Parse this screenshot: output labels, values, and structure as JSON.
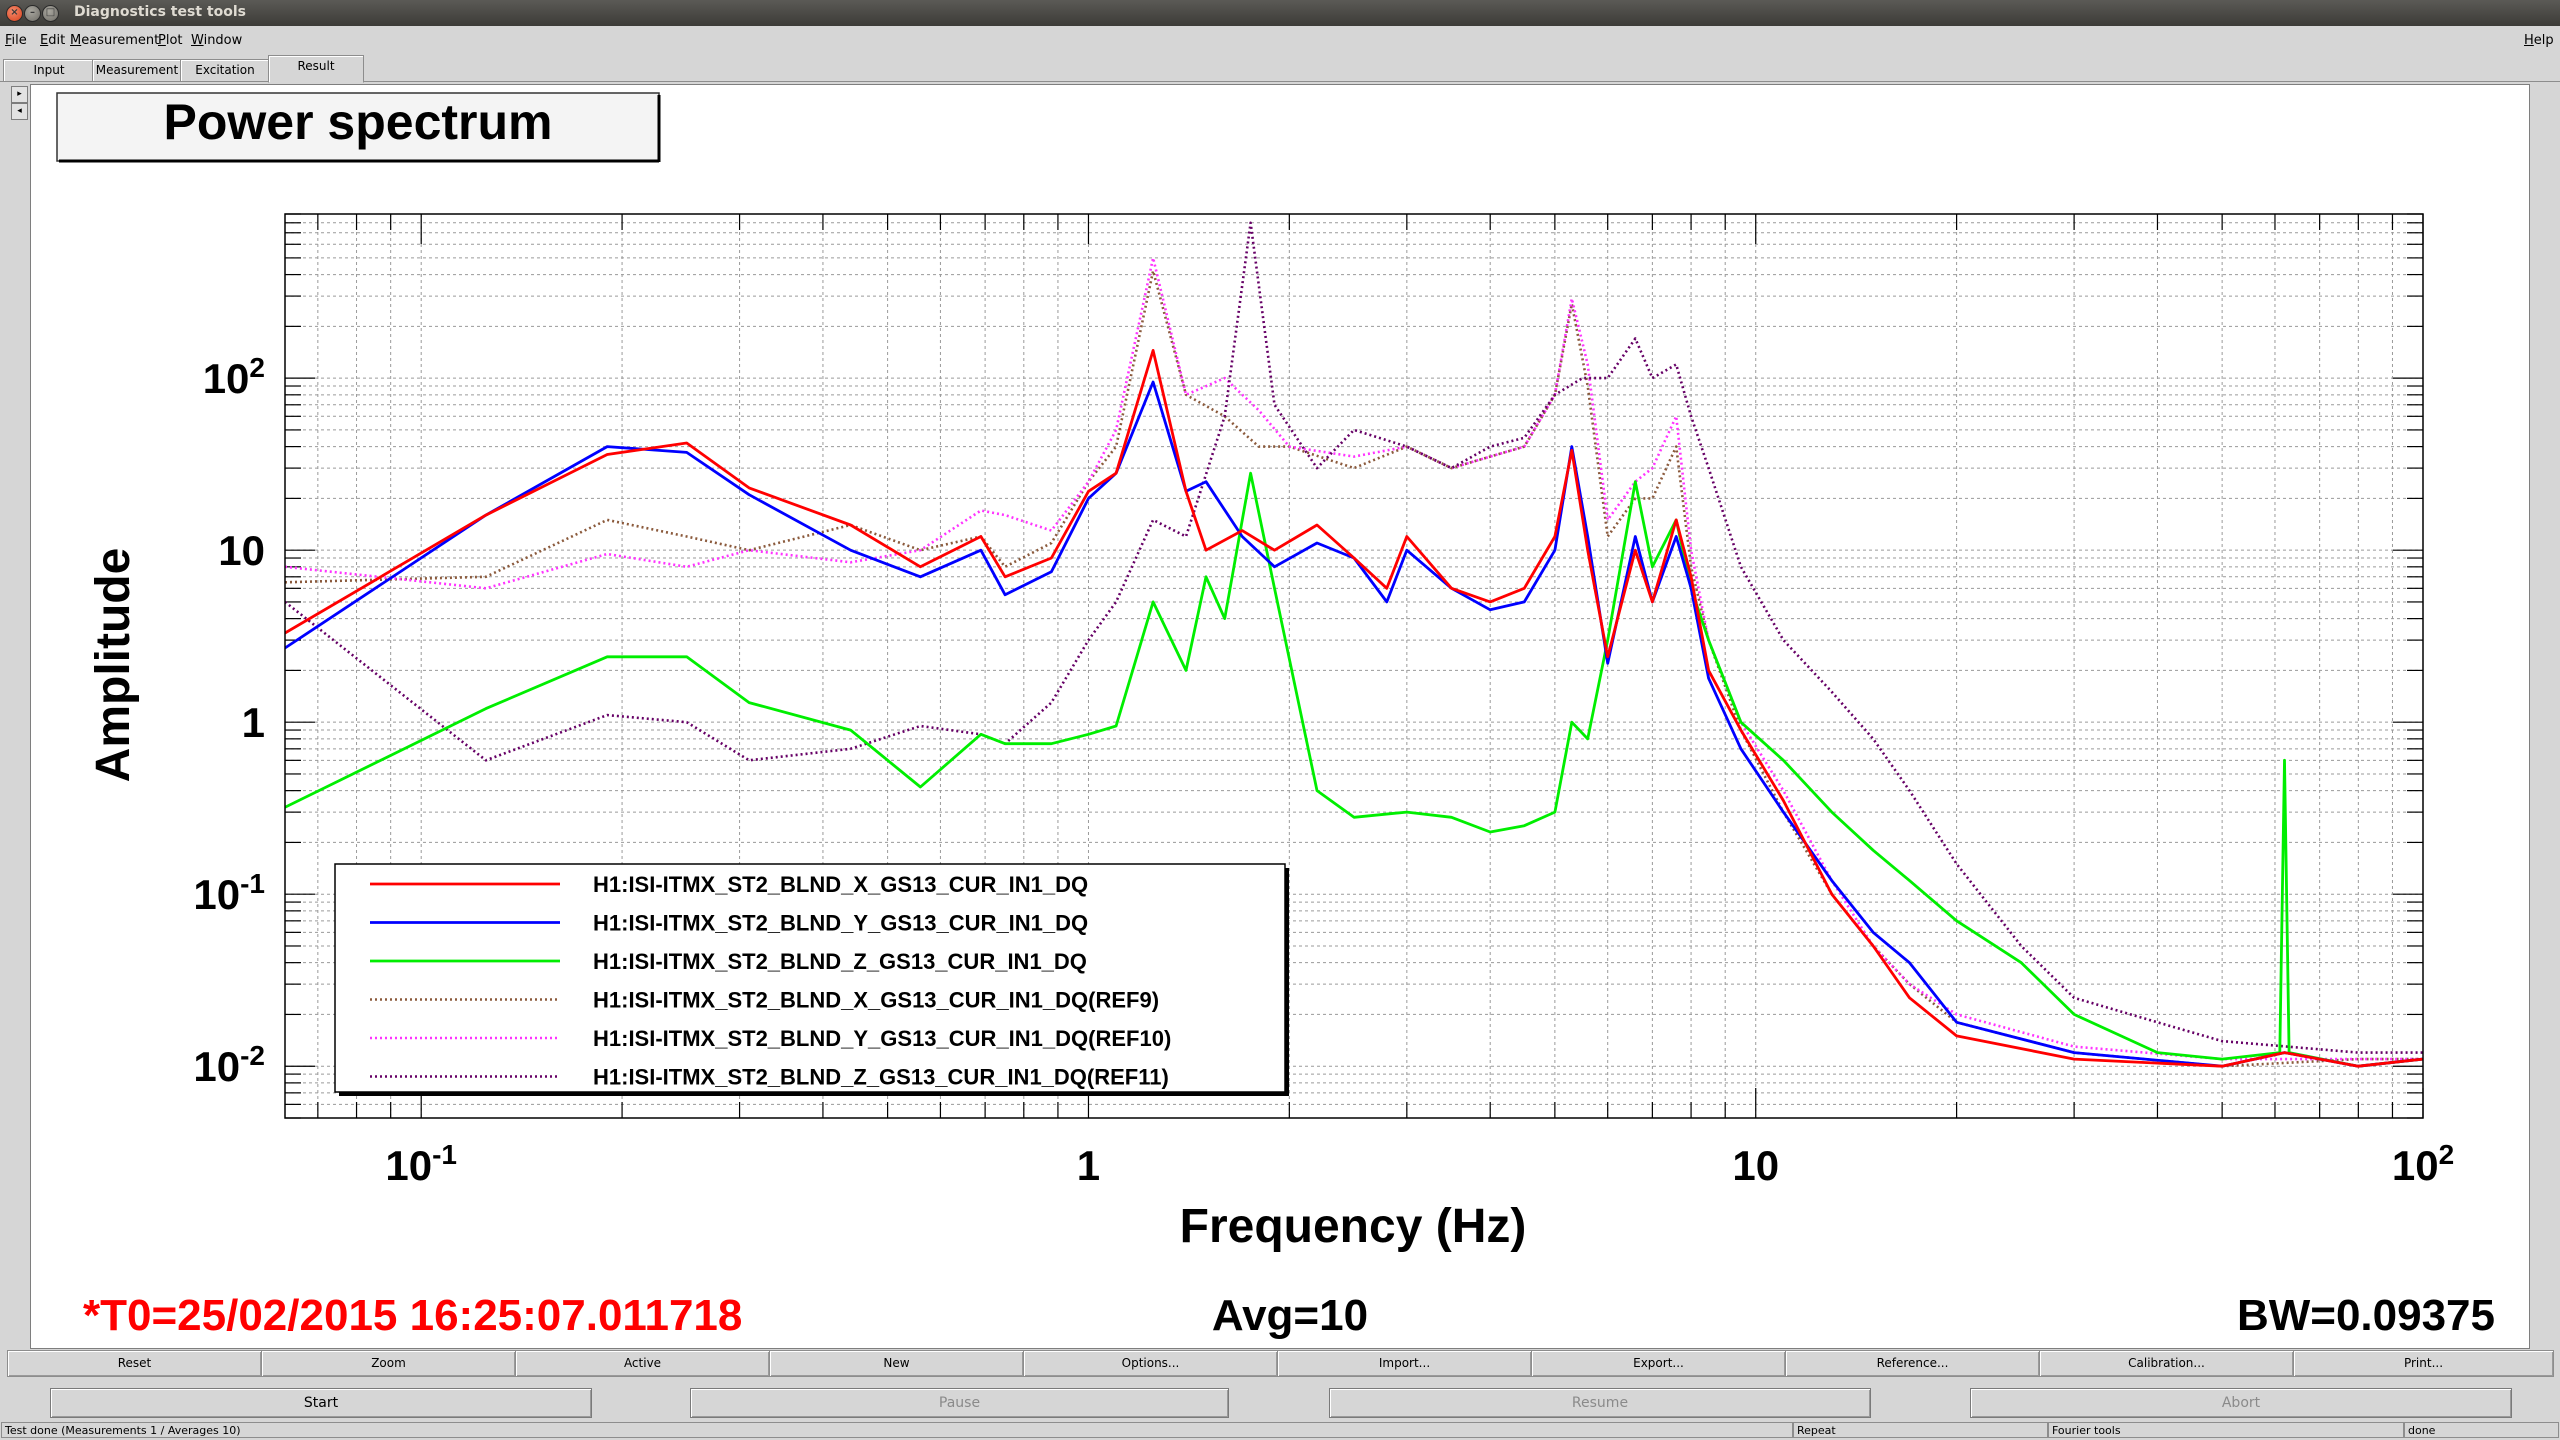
{
  "window": {
    "title": "Diagnostics test tools",
    "close_glyph": "×",
    "min_glyph": "–",
    "max_glyph": "□"
  },
  "menu": {
    "items": [
      "File",
      "Edit",
      "Measurement",
      "Plot",
      "Window"
    ],
    "help": "Help"
  },
  "tabs": [
    "Input",
    "Measurement",
    "Excitation",
    "Result"
  ],
  "active_tab": "Result",
  "scroll": {
    "right": "▸",
    "left": "◂"
  },
  "plot": {
    "title": "Power spectrum",
    "t0": "*T0=25/02/2015 16:25:07.011718",
    "avg": "Avg=10",
    "bw": "BW=0.09375",
    "colors": {
      "X": "#ff0000",
      "Y": "#0000ff",
      "Z": "#00ee00",
      "REF9": "#8b5a3c",
      "REF10": "#ff33ff",
      "REF11": "#660066",
      "t0": "#ff0000"
    }
  },
  "chart_data": {
    "type": "line",
    "title": "Power spectrum",
    "xlabel": "Frequency (Hz)",
    "ylabel": "Amplitude",
    "xscale": "log",
    "yscale": "log",
    "xlim": [
      0.0625,
      100
    ],
    "ylim": [
      0.005,
      900
    ],
    "grid": true,
    "legend_position": "bottom-left",
    "x_ticks": [
      {
        "value": 0.1,
        "base": "10",
        "exp": "-1"
      },
      {
        "value": 1,
        "base": "1",
        "exp": ""
      },
      {
        "value": 10,
        "base": "10",
        "exp": ""
      },
      {
        "value": 100,
        "base": "10",
        "exp": "2"
      }
    ],
    "y_ticks": [
      {
        "value": 100,
        "base": "10",
        "exp": "2"
      },
      {
        "value": 10,
        "base": "10",
        "exp": ""
      },
      {
        "value": 1,
        "base": "1",
        "exp": ""
      },
      {
        "value": 0.1,
        "base": "10",
        "exp": "-1"
      },
      {
        "value": 0.01,
        "base": "10",
        "exp": "-2"
      }
    ],
    "series": [
      {
        "name": "H1:ISI-ITMX_ST2_BLND_X_GS13_CUR_IN1_DQ",
        "key": "X",
        "dash": "solid",
        "points": [
          [
            0.0625,
            3.3
          ],
          [
            0.125,
            16
          ],
          [
            0.19,
            36
          ],
          [
            0.25,
            42
          ],
          [
            0.31,
            23
          ],
          [
            0.44,
            14
          ],
          [
            0.56,
            8
          ],
          [
            0.69,
            12
          ],
          [
            0.75,
            7
          ],
          [
            0.88,
            9
          ],
          [
            1.0,
            22
          ],
          [
            1.1,
            28
          ],
          [
            1.25,
            145
          ],
          [
            1.4,
            22
          ],
          [
            1.5,
            10
          ],
          [
            1.7,
            13
          ],
          [
            1.9,
            10
          ],
          [
            2.2,
            14
          ],
          [
            2.5,
            9
          ],
          [
            2.8,
            6
          ],
          [
            3.0,
            12
          ],
          [
            3.5,
            6
          ],
          [
            4.0,
            5
          ],
          [
            4.5,
            6
          ],
          [
            5.0,
            12
          ],
          [
            5.3,
            38
          ],
          [
            5.6,
            10
          ],
          [
            6.0,
            2.4
          ],
          [
            6.6,
            10
          ],
          [
            7.0,
            5
          ],
          [
            7.6,
            15
          ],
          [
            8.0,
            7
          ],
          [
            8.5,
            2
          ],
          [
            9.5,
            0.9
          ],
          [
            11,
            0.35
          ],
          [
            13,
            0.1
          ],
          [
            15,
            0.05
          ],
          [
            17,
            0.025
          ],
          [
            20,
            0.015
          ],
          [
            30,
            0.011
          ],
          [
            50,
            0.01
          ],
          [
            62,
            0.012
          ],
          [
            80,
            0.01
          ],
          [
            100,
            0.011
          ]
        ]
      },
      {
        "name": "H1:ISI-ITMX_ST2_BLND_Y_GS13_CUR_IN1_DQ",
        "key": "Y",
        "dash": "solid",
        "points": [
          [
            0.0625,
            2.7
          ],
          [
            0.125,
            16
          ],
          [
            0.19,
            40
          ],
          [
            0.25,
            37
          ],
          [
            0.31,
            21
          ],
          [
            0.44,
            10
          ],
          [
            0.56,
            7
          ],
          [
            0.69,
            10
          ],
          [
            0.75,
            5.5
          ],
          [
            0.88,
            7.5
          ],
          [
            1.0,
            20
          ],
          [
            1.1,
            28
          ],
          [
            1.25,
            95
          ],
          [
            1.4,
            22
          ],
          [
            1.5,
            25
          ],
          [
            1.7,
            12
          ],
          [
            1.9,
            8
          ],
          [
            2.2,
            11
          ],
          [
            2.5,
            9
          ],
          [
            2.8,
            5
          ],
          [
            3.0,
            10
          ],
          [
            3.5,
            6
          ],
          [
            4.0,
            4.5
          ],
          [
            4.5,
            5
          ],
          [
            5.0,
            10
          ],
          [
            5.3,
            40
          ],
          [
            5.6,
            12
          ],
          [
            6.0,
            2.2
          ],
          [
            6.6,
            12
          ],
          [
            7.0,
            5
          ],
          [
            7.6,
            12
          ],
          [
            8.0,
            6
          ],
          [
            8.5,
            1.8
          ],
          [
            9.5,
            0.7
          ],
          [
            11,
            0.3
          ],
          [
            13,
            0.12
          ],
          [
            15,
            0.06
          ],
          [
            17,
            0.04
          ],
          [
            20,
            0.018
          ],
          [
            30,
            0.012
          ],
          [
            50,
            0.01
          ],
          [
            62,
            0.012
          ],
          [
            80,
            0.01
          ],
          [
            100,
            0.011
          ]
        ]
      },
      {
        "name": "H1:ISI-ITMX_ST2_BLND_Z_GS13_CUR_IN1_DQ",
        "key": "Z",
        "dash": "solid",
        "points": [
          [
            0.0625,
            0.32
          ],
          [
            0.125,
            1.2
          ],
          [
            0.19,
            2.4
          ],
          [
            0.25,
            2.4
          ],
          [
            0.31,
            1.3
          ],
          [
            0.44,
            0.9
          ],
          [
            0.56,
            0.42
          ],
          [
            0.69,
            0.85
          ],
          [
            0.75,
            0.75
          ],
          [
            0.88,
            0.75
          ],
          [
            1.0,
            0.85
          ],
          [
            1.1,
            0.95
          ],
          [
            1.25,
            5
          ],
          [
            1.4,
            2
          ],
          [
            1.5,
            7
          ],
          [
            1.6,
            4
          ],
          [
            1.75,
            28
          ],
          [
            1.9,
            6
          ],
          [
            2.2,
            0.4
          ],
          [
            2.5,
            0.28
          ],
          [
            3.0,
            0.3
          ],
          [
            3.5,
            0.28
          ],
          [
            4.0,
            0.23
          ],
          [
            4.5,
            0.25
          ],
          [
            5.0,
            0.3
          ],
          [
            5.3,
            1
          ],
          [
            5.6,
            0.8
          ],
          [
            6.0,
            3
          ],
          [
            6.6,
            25
          ],
          [
            7.0,
            8
          ],
          [
            7.6,
            15
          ],
          [
            8.0,
            6
          ],
          [
            8.5,
            3
          ],
          [
            9.5,
            1
          ],
          [
            11,
            0.6
          ],
          [
            13,
            0.3
          ],
          [
            15,
            0.18
          ],
          [
            17,
            0.12
          ],
          [
            20,
            0.07
          ],
          [
            25,
            0.04
          ],
          [
            30,
            0.02
          ],
          [
            40,
            0.012
          ],
          [
            50,
            0.011
          ],
          [
            61,
            0.012
          ],
          [
            62,
            0.6
          ],
          [
            63,
            0.012
          ],
          [
            80,
            0.01
          ],
          [
            100,
            0.011
          ]
        ]
      },
      {
        "name": "H1:ISI-ITMX_ST2_BLND_X_GS13_CUR_IN1_DQ(REF9)",
        "key": "REF9",
        "dash": "dotted",
        "points": [
          [
            0.0625,
            6.5
          ],
          [
            0.125,
            7
          ],
          [
            0.19,
            15
          ],
          [
            0.25,
            12
          ],
          [
            0.31,
            10
          ],
          [
            0.44,
            14
          ],
          [
            0.56,
            10
          ],
          [
            0.69,
            12
          ],
          [
            0.75,
            8
          ],
          [
            0.88,
            11
          ],
          [
            1.0,
            25
          ],
          [
            1.1,
            40
          ],
          [
            1.25,
            420
          ],
          [
            1.4,
            80
          ],
          [
            1.6,
            60
          ],
          [
            1.8,
            40
          ],
          [
            2.0,
            40
          ],
          [
            2.5,
            30
          ],
          [
            3.0,
            40
          ],
          [
            3.5,
            30
          ],
          [
            4.0,
            35
          ],
          [
            4.5,
            40
          ],
          [
            5.0,
            80
          ],
          [
            5.3,
            270
          ],
          [
            5.6,
            90
          ],
          [
            6.0,
            12
          ],
          [
            6.6,
            20
          ],
          [
            7.0,
            20
          ],
          [
            7.6,
            40
          ],
          [
            8.0,
            8
          ],
          [
            8.5,
            3
          ],
          [
            9.5,
            0.9
          ],
          [
            11,
            0.3
          ],
          [
            13,
            0.1
          ],
          [
            15,
            0.05
          ],
          [
            17,
            0.03
          ],
          [
            20,
            0.018
          ],
          [
            30,
            0.012
          ],
          [
            50,
            0.01
          ],
          [
            80,
            0.011
          ],
          [
            100,
            0.011
          ]
        ]
      },
      {
        "name": "H1:ISI-ITMX_ST2_BLND_Y_GS13_CUR_IN1_DQ(REF10)",
        "key": "REF10",
        "dash": "dotted",
        "points": [
          [
            0.0625,
            8
          ],
          [
            0.125,
            6
          ],
          [
            0.19,
            9.5
          ],
          [
            0.25,
            8
          ],
          [
            0.31,
            10
          ],
          [
            0.44,
            8.5
          ],
          [
            0.56,
            10
          ],
          [
            0.69,
            17
          ],
          [
            0.75,
            16
          ],
          [
            0.88,
            13
          ],
          [
            1.0,
            25
          ],
          [
            1.1,
            50
          ],
          [
            1.25,
            500
          ],
          [
            1.4,
            80
          ],
          [
            1.6,
            100
          ],
          [
            1.8,
            65
          ],
          [
            2.0,
            40
          ],
          [
            2.5,
            35
          ],
          [
            3.0,
            40
          ],
          [
            3.5,
            30
          ],
          [
            4.0,
            35
          ],
          [
            4.5,
            40
          ],
          [
            5.0,
            80
          ],
          [
            5.3,
            290
          ],
          [
            5.6,
            120
          ],
          [
            6.0,
            15
          ],
          [
            6.6,
            25
          ],
          [
            7.0,
            30
          ],
          [
            7.6,
            60
          ],
          [
            8.0,
            10
          ],
          [
            8.5,
            3
          ],
          [
            9.5,
            1
          ],
          [
            11,
            0.4
          ],
          [
            13,
            0.12
          ],
          [
            15,
            0.05
          ],
          [
            17,
            0.03
          ],
          [
            20,
            0.02
          ],
          [
            30,
            0.013
          ],
          [
            50,
            0.011
          ],
          [
            80,
            0.011
          ],
          [
            100,
            0.011
          ]
        ]
      },
      {
        "name": "H1:ISI-ITMX_ST2_BLND_Z_GS13_CUR_IN1_DQ(REF11)",
        "key": "REF11",
        "dash": "dotted",
        "points": [
          [
            0.0625,
            5
          ],
          [
            0.125,
            0.6
          ],
          [
            0.19,
            1.1
          ],
          [
            0.25,
            1
          ],
          [
            0.31,
            0.6
          ],
          [
            0.44,
            0.7
          ],
          [
            0.56,
            0.95
          ],
          [
            0.69,
            0.85
          ],
          [
            0.75,
            0.75
          ],
          [
            0.88,
            1.3
          ],
          [
            1.0,
            3
          ],
          [
            1.1,
            5
          ],
          [
            1.25,
            15
          ],
          [
            1.4,
            12
          ],
          [
            1.6,
            60
          ],
          [
            1.75,
            800
          ],
          [
            1.9,
            70
          ],
          [
            2.2,
            30
          ],
          [
            2.5,
            50
          ],
          [
            3.0,
            40
          ],
          [
            3.5,
            30
          ],
          [
            4.0,
            40
          ],
          [
            4.5,
            45
          ],
          [
            5.0,
            80
          ],
          [
            5.5,
            100
          ],
          [
            6.0,
            100
          ],
          [
            6.6,
            170
          ],
          [
            7.0,
            100
          ],
          [
            7.6,
            120
          ],
          [
            8.0,
            60
          ],
          [
            8.5,
            30
          ],
          [
            9.5,
            8
          ],
          [
            11,
            3
          ],
          [
            13,
            1.5
          ],
          [
            15,
            0.8
          ],
          [
            17,
            0.4
          ],
          [
            20,
            0.15
          ],
          [
            25,
            0.05
          ],
          [
            30,
            0.025
          ],
          [
            40,
            0.018
          ],
          [
            50,
            0.014
          ],
          [
            80,
            0.012
          ],
          [
            100,
            0.012
          ]
        ]
      }
    ]
  },
  "bottom_buttons": [
    "Reset",
    "Zoom",
    "Active",
    "New",
    "Options...",
    "Import...",
    "Export...",
    "Reference...",
    "Calibration...",
    "Print..."
  ],
  "control_buttons": [
    {
      "label": "Start",
      "enabled": true
    },
    {
      "label": "Pause",
      "enabled": false
    },
    {
      "label": "Resume",
      "enabled": false
    },
    {
      "label": "Abort",
      "enabled": false
    }
  ],
  "status": {
    "message": "Test done (Measurements 1 / Averages 10)",
    "repeat": "Repeat",
    "tools": "Fourier tools",
    "state": "done"
  }
}
